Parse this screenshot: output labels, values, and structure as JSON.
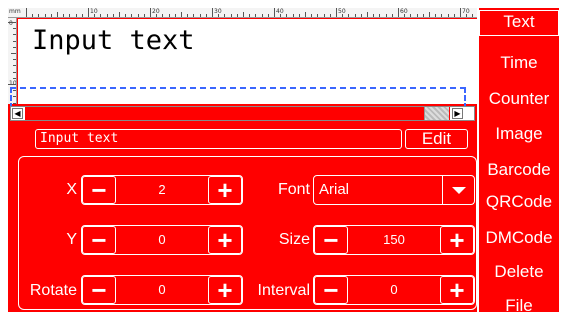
{
  "ruler": {
    "unit": "mm",
    "top_ticks": [
      "10",
      "20",
      "30",
      "40",
      "50",
      "60",
      "70"
    ],
    "left_ticks": [
      "0",
      "10"
    ]
  },
  "canvas": {
    "text": "Input text"
  },
  "text_input": {
    "value": "Input text"
  },
  "edit_button": {
    "label": "Edit"
  },
  "properties": {
    "x": {
      "label": "X",
      "value": "2"
    },
    "y": {
      "label": "Y",
      "value": "0"
    },
    "rotate": {
      "label": "Rotate",
      "value": "0"
    },
    "font": {
      "label": "Font",
      "value": "Arial"
    },
    "size": {
      "label": "Size",
      "value": "150"
    },
    "interval": {
      "label": "Interval",
      "value": "0"
    },
    "minus_symbol": "−",
    "plus_symbol": "+"
  },
  "sidebar": {
    "items": [
      {
        "label": "Text"
      },
      {
        "label": "Time"
      },
      {
        "label": "Counter"
      },
      {
        "label": "Image"
      },
      {
        "label": "Barcode"
      },
      {
        "label": "QRCode"
      },
      {
        "label": "DMCode"
      },
      {
        "label": "Delete"
      },
      {
        "label": "File"
      }
    ]
  },
  "colors": {
    "background": "#ff0000",
    "foreground": "#ffffff",
    "selection": "#3b66ff"
  },
  "icons": {
    "scroll_left": "triangle-left-icon",
    "scroll_right": "triangle-right-icon",
    "dropdown": "chevron-down-icon"
  }
}
